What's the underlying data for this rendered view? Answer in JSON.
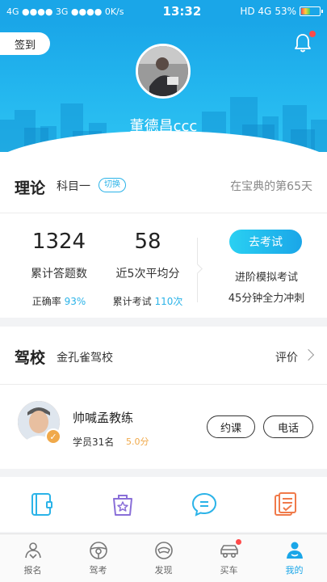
{
  "status_bar": {
    "left": "4G ●●●● 3G ●●●● 0K/s",
    "time": "13:32",
    "network": "HD 4G",
    "battery": "53%",
    "battery_level": 0.53
  },
  "header": {
    "checkin_label": "签到",
    "username": "董德昌ccc"
  },
  "theory": {
    "title": "理论",
    "subject": "科目一",
    "switch_label": "切换",
    "days_text": "在宝典的第65天",
    "answered_count": "1324",
    "answered_label": "累计答题数",
    "accuracy_label": "正确率",
    "accuracy_value": "93%",
    "avg_score": "58",
    "avg_label": "近5次平均分",
    "exams_label": "累计考试",
    "exams_value": "110次",
    "exam_button": "去考试",
    "exam_desc_1": "进阶模拟考试",
    "exam_desc_2": "45分钟全力冲刺"
  },
  "school": {
    "title": "驾校",
    "name": "金孔雀驾校",
    "evaluate_label": "评价",
    "coach_name": "帅喊孟教练",
    "students": "学员31名",
    "score": "5.0分",
    "book_label": "约课",
    "call_label": "电话"
  },
  "shortcuts": [
    {
      "icon": "notebook-icon",
      "color": "#2bb3e8"
    },
    {
      "icon": "star-bag-icon",
      "color": "#8a6fd8"
    },
    {
      "icon": "message-icon",
      "color": "#2bb3e8"
    },
    {
      "icon": "checklist-icon",
      "color": "#f07a4a"
    }
  ],
  "tabs": [
    {
      "label": "报名",
      "icon": "signup-icon"
    },
    {
      "label": "驾考",
      "icon": "steering-wheel-icon"
    },
    {
      "label": "发现",
      "icon": "discover-icon"
    },
    {
      "label": "买车",
      "icon": "car-icon"
    },
    {
      "label": "我的",
      "icon": "profile-icon"
    }
  ],
  "colors": {
    "accent": "#1aa6e8",
    "score": "#f0a94a",
    "dot": "#ff4a4a"
  }
}
